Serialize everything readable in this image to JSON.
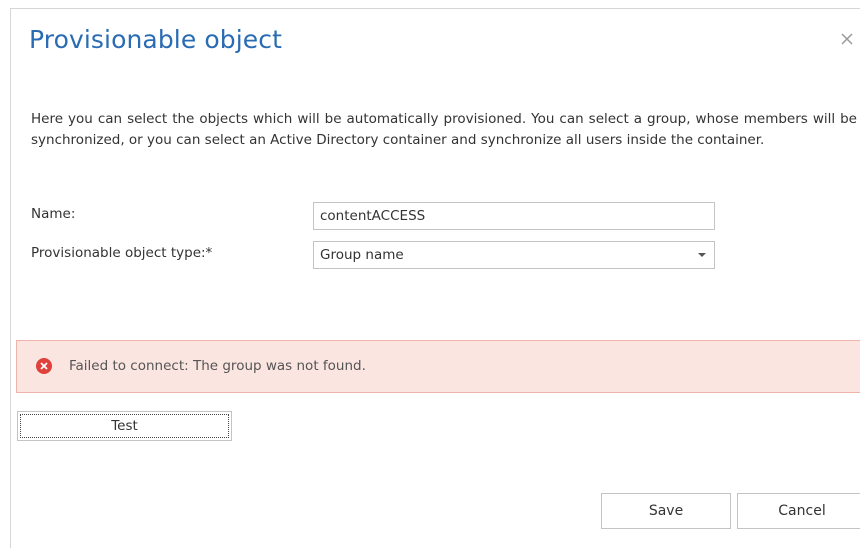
{
  "dialog": {
    "title": "Provisionable object",
    "close_icon": "close-icon",
    "description": "Here you can select the objects which will be automatically provisioned. You can select a group, whose members will be synchronized, or you can select an Active Directory container and synchronize all users inside the container."
  },
  "form": {
    "name_label": "Name:",
    "name_value": "contentACCESS",
    "type_label": "Provisionable object type:*",
    "type_value": "Group name"
  },
  "error": {
    "icon": "error-circle-icon",
    "message": "Failed to connect: The group was not found.",
    "color": "#e0413a"
  },
  "buttons": {
    "test_label": "Test",
    "save_label": "Save",
    "cancel_label": "Cancel"
  },
  "colors": {
    "title": "#2a6cb3",
    "error_background": "#fbe5e1",
    "error_border": "#f0b5aa"
  }
}
